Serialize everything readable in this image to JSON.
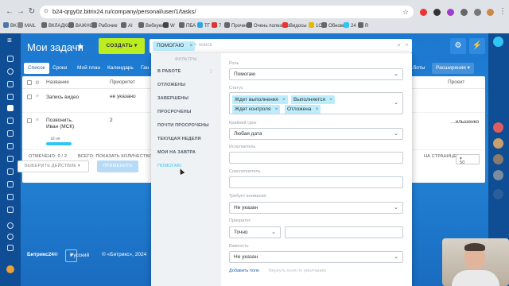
{
  "browser": {
    "url": "b24-qrgy0z.bitrix24.ru/company/personal/user/1/tasks/",
    "bookmarks": [
      {
        "label": "BK",
        "color": "#4a76a8"
      },
      {
        "label": "MAIL",
        "color": "#888888"
      },
      {
        "label": "ВКЛАДКИ",
        "color": "#666666"
      },
      {
        "label": "ВАЖНО",
        "color": "#666666"
      },
      {
        "label": "Рабочие",
        "color": "#666666"
      },
      {
        "label": "AI",
        "color": "#666666"
      },
      {
        "label": "Вебхуки",
        "color": "#666666"
      },
      {
        "label": "W",
        "color": "#444444"
      },
      {
        "label": "ПБА",
        "color": "#666666"
      },
      {
        "label": "ТГ",
        "color": "#2ca5e0"
      },
      {
        "label": "7",
        "color": "#d33"
      },
      {
        "label": "Прочее",
        "color": "#666666"
      },
      {
        "label": "Очень полезное",
        "color": "#666666"
      },
      {
        "label": "Видосы",
        "color": "#e33"
      },
      {
        "label": "1С",
        "color": "#e6b800"
      },
      {
        "label": "Обновы",
        "color": "#666666"
      },
      {
        "label": "24",
        "color": "#2fc6f6"
      },
      {
        "label": "R",
        "color": "#666666"
      }
    ]
  },
  "header": {
    "title": "Мои задачи",
    "create_label": "СОЗДАТЬ",
    "filter_chip": "ПОМОГАЮ",
    "search_placeholder": "+ поиск"
  },
  "tabs": [
    "Список",
    "Сроки",
    "Мой план",
    "Календарь",
    "Ган"
  ],
  "tabs_right": [
    "…боты",
    "Расширения"
  ],
  "grid": {
    "columns": [
      "Название",
      "Приоритет",
      "Проект"
    ],
    "rows": [
      {
        "name": "Запись видео",
        "priority": "не указано",
        "extra": ""
      },
      {
        "name": "Позвонить, Иван (МСК)",
        "priority": "2",
        "extra": "…ильшенко"
      }
    ],
    "row_tag": "Ш ня",
    "footer_marked": "ОТМЕЧЕНО: 0 / 2",
    "footer_total": "ВСЕГО: ПОКАЗАТЬ КОЛИЧЕСТВО",
    "per_page_label": "НА СТРАНИЦЕ:",
    "per_page_value": "50",
    "action_placeholder": "ВЫБЕРИТЕ ДЕЙСТВИЕ",
    "apply_label": "ПРИМЕНИТЬ"
  },
  "filter_popup": {
    "presets_title": "ФИЛЬТРЫ",
    "presets": [
      "В РАБОТЕ",
      "ОТЛОЖЕНЫ",
      "ЗАВЕРШЕНЫ",
      "ПРОСРОЧЕНЫ",
      "ПОЧТИ ПРОСРОЧЕНЫ",
      "ТЕКУЩАЯ НЕДЕЛЯ",
      "МОИ НА ЗАВТРА",
      "ПОМОГАЮ"
    ],
    "active_preset": "ПОМОГАЮ",
    "fields": {
      "role_label": "Роль",
      "role_value": "Помогаю",
      "status_label": "Статус",
      "status_chips": [
        "Ждет выполнения",
        "Выполняется",
        "Ждет контроля",
        "Отложена"
      ],
      "deadline_label": "Крайний срок",
      "deadline_value": "Любая дата",
      "executor_label": "Исполнитель",
      "coexec_label": "Соисполнитель",
      "attention_label": "Требует внимания",
      "attention_value": "Не указан",
      "priority_label": "Приоритет",
      "priority_value": "Точно",
      "importance_label": "Важность",
      "importance_value": "Не указан"
    },
    "add_field": "Добавить поле",
    "reset_fields": "Вернуть поля по умолчанию"
  },
  "footer": {
    "brand": "Битрикс24©",
    "language": "Русский",
    "copyright": "© «Битрикс», 2024"
  }
}
